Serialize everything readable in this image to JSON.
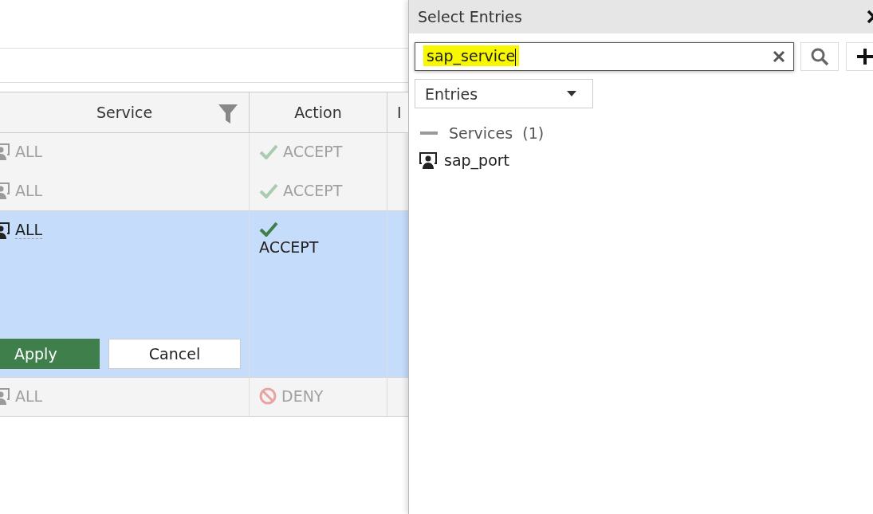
{
  "table": {
    "columns": [
      {
        "label": "Service",
        "filter": true
      },
      {
        "label": "Action",
        "filter": false
      },
      {
        "label": "I",
        "filter": false
      }
    ],
    "rows": [
      {
        "service": "ALL",
        "action": {
          "kind": "accept",
          "label": "ACCEPT"
        },
        "disabled": true,
        "selected": false,
        "group_end": false
      },
      {
        "service": "ALL",
        "action": {
          "kind": "accept",
          "label": "ACCEPT"
        },
        "disabled": true,
        "selected": false,
        "group_end": true
      },
      {
        "service": "ALL",
        "action": {
          "kind": "accept",
          "label": "ACCEPT"
        },
        "disabled": false,
        "selected": true,
        "group_end": true,
        "editing": {
          "apply": "Apply",
          "cancel": "Cancel"
        }
      },
      {
        "service": "ALL",
        "action": {
          "kind": "deny",
          "label": "DENY"
        },
        "disabled": true,
        "selected": false,
        "group_end": true
      }
    ]
  },
  "panel": {
    "title": "Select Entries",
    "search": {
      "value": "sap_service",
      "highlighted": true
    },
    "filter": {
      "value": "Entries"
    },
    "tree": [
      {
        "label": "Services",
        "count": "(1)",
        "expanded": true,
        "children": [
          {
            "label": "sap_port"
          }
        ]
      }
    ]
  }
}
